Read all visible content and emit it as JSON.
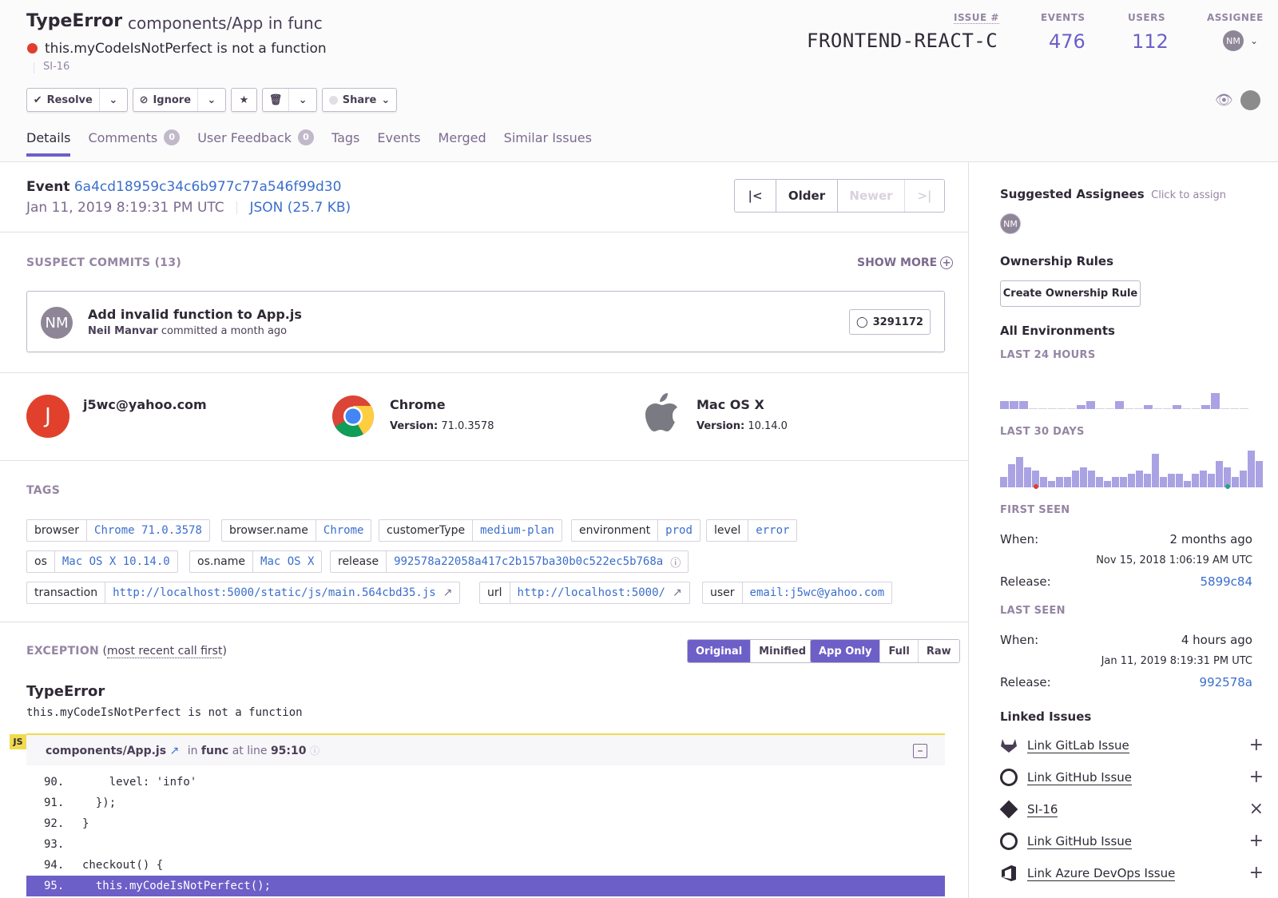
{
  "issue": {
    "type": "TypeError",
    "culprit": "components/App in func",
    "message": "this.myCodeIsNotPerfect is not a function",
    "short_id": "SI-16",
    "issue_label": "ISSUE #",
    "issue_number": "FRONTEND-REACT-C",
    "events_label": "EVENTS",
    "events_count": "476",
    "users_label": "USERS",
    "users_count": "112",
    "assignee_label": "ASSIGNEE",
    "assignee_initials": "NM"
  },
  "actions": {
    "resolve": "Resolve",
    "ignore": "Ignore",
    "share": "Share"
  },
  "tabs": [
    {
      "label": "Details"
    },
    {
      "label": "Comments",
      "count": "0"
    },
    {
      "label": "User Feedback",
      "count": "0"
    },
    {
      "label": "Tags"
    },
    {
      "label": "Events"
    },
    {
      "label": "Merged"
    },
    {
      "label": "Similar Issues"
    }
  ],
  "event": {
    "label": "Event",
    "id": "6a4cd18959c34c6b977c77a546f99d30",
    "date": "Jan 11, 2019 8:19:31 PM UTC",
    "json": "JSON (25.7 KB)",
    "older": "Older",
    "newer": "Newer"
  },
  "suspect_commits": {
    "title": "SUSPECT COMMITS (13)",
    "show_more": "SHOW MORE",
    "initials": "NM",
    "message": "Add invalid function to App.js",
    "author": "Neil Manvar",
    "when": "committed a month ago",
    "sha": "3291172"
  },
  "context": {
    "user_initial": "J",
    "user": "j5wc@yahoo.com",
    "browser_name": "Chrome",
    "browser_version_label": "Version:",
    "browser_version": "71.0.3578",
    "os_name": "Mac OS X",
    "os_version_label": "Version:",
    "os_version": "10.14.0"
  },
  "tags": {
    "title": "TAGS",
    "items": [
      {
        "key": "browser",
        "value": "Chrome 71.0.3578"
      },
      {
        "key": "browser.name",
        "value": "Chrome"
      },
      {
        "key": "customerType",
        "value": "medium-plan"
      },
      {
        "key": "environment",
        "value": "prod"
      },
      {
        "key": "level",
        "value": "error"
      },
      {
        "key": "os",
        "value": "Mac OS X 10.14.0"
      },
      {
        "key": "os.name",
        "value": "Mac OS X"
      },
      {
        "key": "release",
        "value": "992578a22058a417c2b157ba30b0c522ec5b768a"
      },
      {
        "key": "transaction",
        "value": "http://localhost:5000/static/js/main.564cbd35.js"
      },
      {
        "key": "url",
        "value": "http://localhost:5000/"
      },
      {
        "key": "user",
        "value": "email:j5wc@yahoo.com"
      }
    ]
  },
  "exception": {
    "title": "EXCEPTION",
    "subtitle": "most recent call first",
    "original": "Original",
    "minified": "Minified",
    "app_only": "App Only",
    "full": "Full",
    "raw": "Raw",
    "type": "TypeError",
    "value": "this.myCodeIsNotPerfect is not a function",
    "platform": "JS",
    "file": "components/App.js",
    "in_label": "in",
    "function": "func",
    "at_line_label": "at line",
    "line": "95:10",
    "lines": [
      {
        "n": "90.",
        "code": "    level: 'info'"
      },
      {
        "n": "91.",
        "code": "  });"
      },
      {
        "n": "92.",
        "code": "}"
      },
      {
        "n": "93.",
        "code": ""
      },
      {
        "n": "94.",
        "code": "checkout() {"
      },
      {
        "n": "95.",
        "code": "  this.myCodeIsNotPerfect();"
      }
    ]
  },
  "sidebar": {
    "suggested": "Suggested Assignees",
    "click_to_assign": "Click to assign",
    "suggested_initials": "NM",
    "ownership": "Ownership Rules",
    "create_rule": "Create Ownership Rule",
    "environments": "All Environments",
    "last24": "LAST 24 HOURS",
    "last30": "LAST 30 DAYS",
    "bars24": [
      2,
      2,
      2,
      0,
      0,
      0,
      0,
      0,
      1,
      2,
      0,
      0,
      2,
      0,
      0,
      1,
      0,
      0,
      1,
      0,
      0,
      1,
      4,
      0,
      0,
      0
    ],
    "bars30": [
      3,
      7,
      9,
      6,
      5,
      3,
      2,
      3,
      3,
      5,
      6,
      5,
      3,
      2,
      3,
      3,
      4,
      5,
      4,
      10,
      3,
      4,
      4,
      2,
      4,
      5,
      4,
      8,
      6,
      3,
      5,
      11,
      8
    ],
    "first_seen": "FIRST SEEN",
    "when_label": "When:",
    "first_when": "2 months ago",
    "first_date": "Nov 15, 2018 1:06:19 AM UTC",
    "release_label": "Release:",
    "first_release": "5899c84",
    "last_seen": "LAST SEEN",
    "last_when": "4 hours ago",
    "last_date": "Jan 11, 2019 8:19:31 PM UTC",
    "last_release": "992578a",
    "linked_title": "Linked Issues",
    "linked": [
      {
        "label": "Link GitLab Issue",
        "action": "+"
      },
      {
        "label": "Link GitHub Issue",
        "action": "+"
      },
      {
        "label": "SI-16",
        "action": "×"
      },
      {
        "label": "Link GitHub Issue",
        "action": "+"
      },
      {
        "label": "Link Azure DevOps Issue",
        "action": "+"
      }
    ]
  },
  "colors": {
    "accent": "#6c5fc7",
    "link": "#3b6ecc",
    "error": "#e03e2f",
    "bar": "#a9a2e3"
  }
}
